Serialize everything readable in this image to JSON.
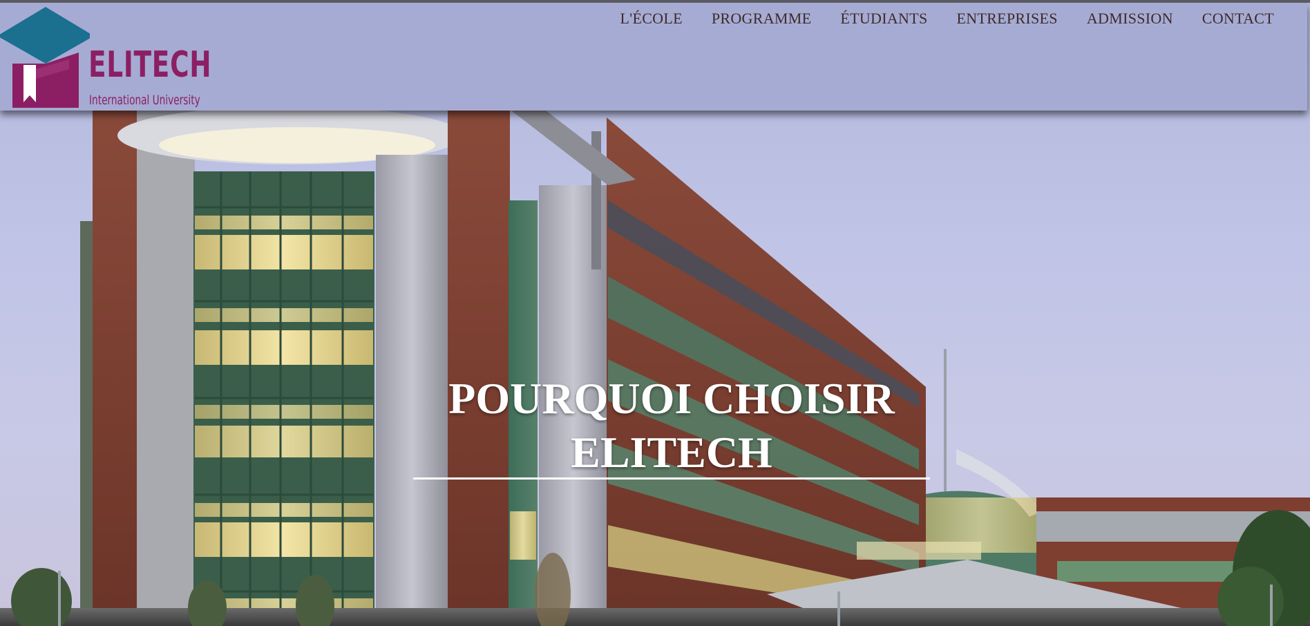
{
  "brand": {
    "name": "ELITECH",
    "tagline": "International University",
    "colors": {
      "primary": "#8c1f63",
      "cap": "#1b6f8f",
      "header_bg": "#a6abd3",
      "nav_text": "#3d2a2a"
    }
  },
  "nav": {
    "items": [
      {
        "label": "L'ÉCOLE"
      },
      {
        "label": "PROGRAMME"
      },
      {
        "label": "ÉTUDIANTS"
      },
      {
        "label": "ENTREPRISES"
      },
      {
        "label": "ADMISSION"
      },
      {
        "label": "CONTACT"
      }
    ]
  },
  "hero": {
    "title_line1": "POURQUOI CHOISIR",
    "title_line2": "ELITECH",
    "background": "campus-building-photo"
  }
}
